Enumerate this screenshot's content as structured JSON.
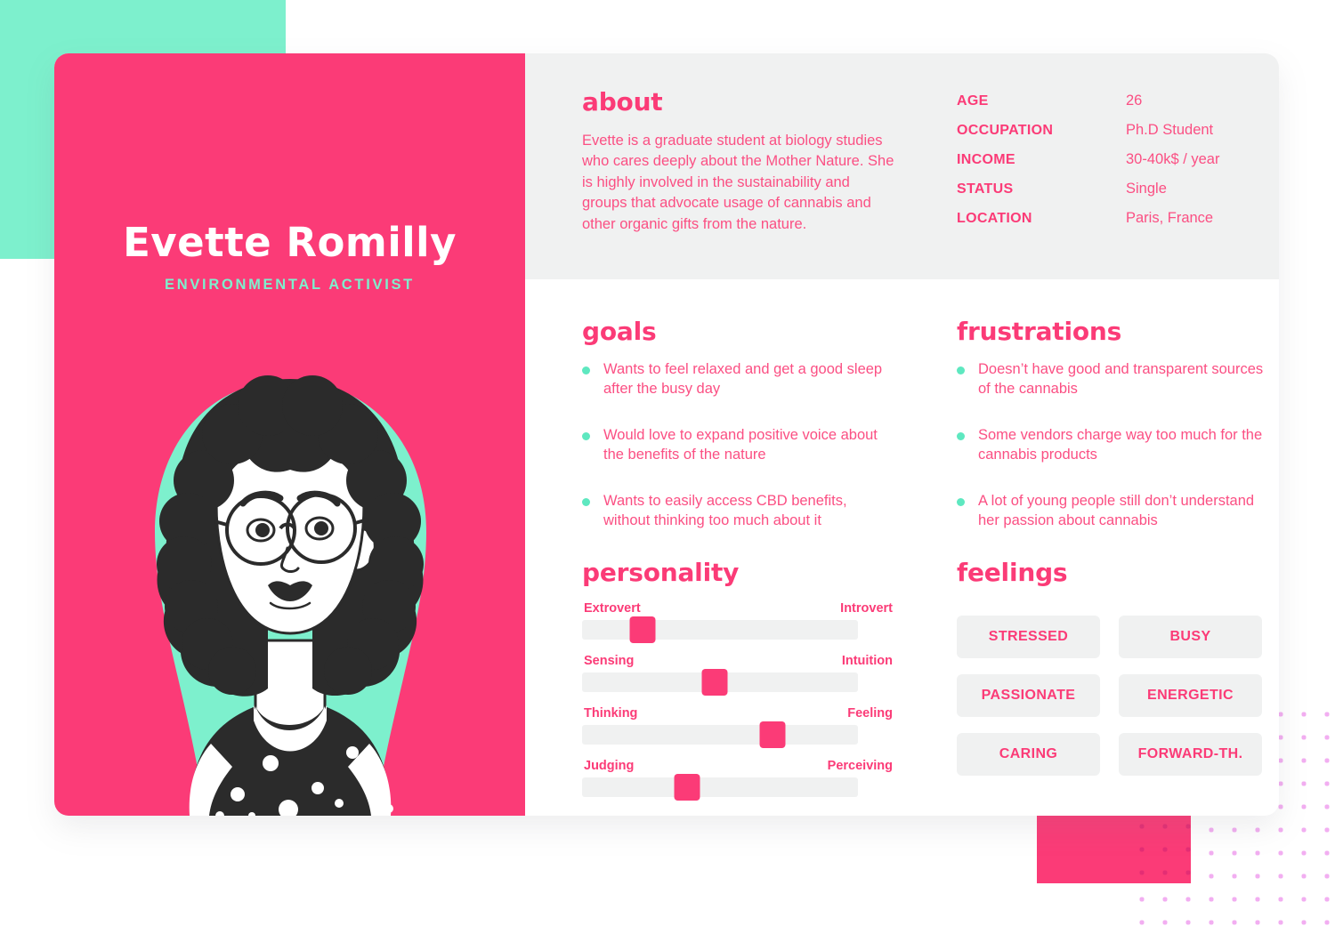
{
  "persona": {
    "name": "Evette Romilly",
    "role": "ENVIRONMENTAL ACTIVIST"
  },
  "about": {
    "title": "about",
    "text": "Evette is a graduate student at biology studies who cares deeply about the Mother Nature. She is highly involved in the sustainability and groups that advocate usage of cannabis and other organic gifts from the nature."
  },
  "demographics": [
    {
      "label": "AGE",
      "value": "26"
    },
    {
      "label": "OCCUPATION",
      "value": "Ph.D Student"
    },
    {
      "label": "INCOME",
      "value": "30-40k$ / year"
    },
    {
      "label": "STATUS",
      "value": "Single"
    },
    {
      "label": "LOCATION",
      "value": "Paris, France"
    }
  ],
  "goals": {
    "title": "goals",
    "items": [
      "Wants to feel relaxed and get a good sleep after the busy day",
      "Would love to expand positive voice about the benefits of the nature",
      "Wants to easily access CBD benefits, without thinking too much about it"
    ]
  },
  "frustrations": {
    "title": "frustrations",
    "items": [
      "Doesn’t have good and transparent sources of the cannabis",
      "Some vendors charge way too much for the cannabis products",
      "A lot of young people still don’t understand her passion about cannabis"
    ]
  },
  "personality": {
    "title": "personality",
    "sliders": [
      {
        "left": "Extrovert",
        "right": "Introvert",
        "value": 22
      },
      {
        "left": "Sensing",
        "right": "Intuition",
        "value": 48
      },
      {
        "left": "Thinking",
        "right": "Feeling",
        "value": 69
      },
      {
        "left": "Judging",
        "right": "Perceiving",
        "value": 38
      }
    ]
  },
  "feelings": {
    "title": "feelings",
    "chips": [
      "STRESSED",
      "BUSY",
      "PASSIONATE",
      "ENERGETIC",
      "CARING",
      "FORWARD-TH."
    ]
  },
  "colors": {
    "pink": "#fb3b77",
    "pink_text": "#fb4f83",
    "mint": "#7df0cd",
    "mint_bullet": "#5ee8c0",
    "gray": "#f0f1f1",
    "dark": "#2b2b2b",
    "dot": "#ea7de8"
  }
}
